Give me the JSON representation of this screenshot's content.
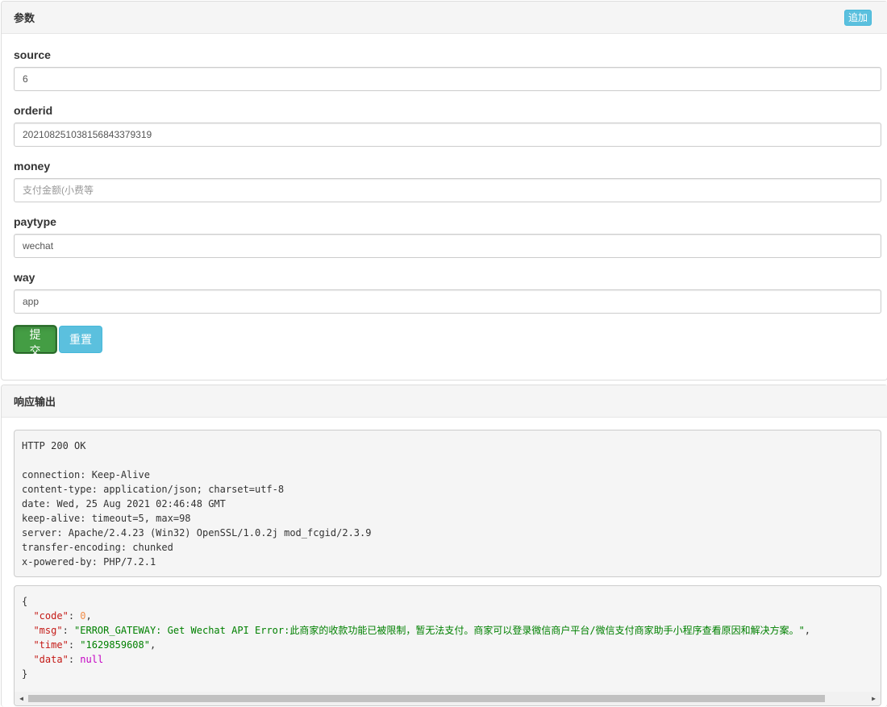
{
  "params_panel": {
    "title": "参数",
    "add_label": "追加",
    "fields": [
      {
        "label": "source",
        "value": "6",
        "placeholder": ""
      },
      {
        "label": "orderid",
        "value": "20210825103815684337931​9",
        "placeholder": ""
      },
      {
        "label": "money",
        "value": "",
        "placeholder": "支付金额(小费等"
      },
      {
        "label": "paytype",
        "value": "wechat",
        "placeholder": ""
      },
      {
        "label": "way",
        "value": "app",
        "placeholder": ""
      }
    ],
    "submit_label": "提交",
    "reset_label": "重置"
  },
  "output_panel": {
    "title": "响应输出",
    "headers_text": "HTTP 200 OK\n\nconnection: Keep-Alive\ncontent-type: application/json; charset=utf-8\ndate: Wed, 25 Aug 2021 02:46:48 GMT\nkeep-alive: timeout=5, max=98\nserver: Apache/2.4.23 (Win32) OpenSSL/1.0.2j mod_fcgid/2.3.9\ntransfer-encoding: chunked\nx-powered-by: PHP/7.2.1",
    "json": {
      "open_brace": "{",
      "close_brace": "}",
      "code_key": "\"code\"",
      "code_val": "0",
      "msg_key": "\"msg\"",
      "msg_val": "\"ERROR_GATEWAY: Get Wechat API Error:此商家的收款功能已被限制，暂无法支付。商家可以登录微信商户平台/微信支付商家助手小程序查看原因和解决方案。\"",
      "time_key": "\"time\"",
      "time_val": "\"1629859608\"",
      "data_key": "\"data\"",
      "data_val": "null"
    },
    "scroll_fraction": 0.95
  },
  "colors": {
    "submit_bg": "#449d44",
    "info_bg": "#5bc0de",
    "string_green": "#008000",
    "number_orange": "#f08d49",
    "null_magenta": "#c400c4",
    "key_red": "#c41a16"
  }
}
